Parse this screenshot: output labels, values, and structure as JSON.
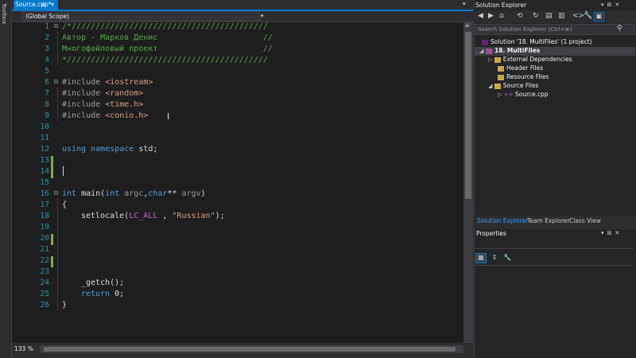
{
  "toolbox": {
    "label": "Toolbox"
  },
  "editor": {
    "tab_title": "Source.cpp*",
    "scope": "(Global Scope)",
    "zoom": "133 %",
    "line_numbers": [
      "1",
      "2",
      "3",
      "4",
      "5",
      "6",
      "7",
      "8",
      "9",
      "10",
      "11",
      "12",
      "13",
      "14",
      "15",
      "16",
      "17",
      "18",
      "19",
      "20",
      "21",
      "22",
      "23",
      "24",
      "25",
      "26"
    ],
    "lines": {
      "l1": "/*/////////////////////////////////////////",
      "l2": "Автор - Марков Денис                      //",
      "l3": "Многофайловый проект                      //",
      "l4": "*//////////////////////////////////////////",
      "l6_pp": "#include ",
      "l6_inc": "<iostream>",
      "l7_pp": "#include ",
      "l7_inc": "<random>",
      "l8_pp": "#include ",
      "l8_inc": "<time.h>",
      "l9_pp": "#include ",
      "l9_inc": "<conio.h>",
      "l12_kw1": "using",
      "l12_kw2": "namespace",
      "l12_rest": " std;",
      "l16_kw1": "int",
      "l16_a": " main(",
      "l16_kw2": "int",
      "l16_p1": " argc",
      "l16_b": ",",
      "l16_kw3": "char",
      "l16_c": "** ",
      "l16_p2": "argv",
      "l16_d": ")",
      "l17": "{",
      "l18_a": "setlocale(",
      "l18_mac": "LC_ALL",
      "l18_b": " , ",
      "l18_str": "\"Russian\"",
      "l18_c": ");",
      "l24": "_getch();",
      "l25_kw": "return",
      "l25_rest": " 0;",
      "l26": "}"
    }
  },
  "solution_explorer": {
    "title": "Solution Explorer",
    "search_placeholder": "Search Solution Explorer (Ctrl+ж)",
    "solution": "Solution '18. MultiFiles' (1 project)",
    "project": "18. MultiFiles",
    "nodes": {
      "external": "External Dependencies",
      "headers": "Header Files",
      "resources": "Resource Files",
      "sources": "Source Files",
      "source_cpp": "Source.cpp"
    },
    "tabs": [
      "Solution Explorer",
      "Team Explorer",
      "Class View"
    ]
  },
  "properties": {
    "title": "Properties"
  },
  "colors": {
    "accent": "#007acc",
    "comment": "#57a64a",
    "keyword": "#569cd6",
    "macro": "#bd63c5",
    "string": "#d69d85",
    "line_number": "#2b91af",
    "change_marker": "#86a83b"
  }
}
